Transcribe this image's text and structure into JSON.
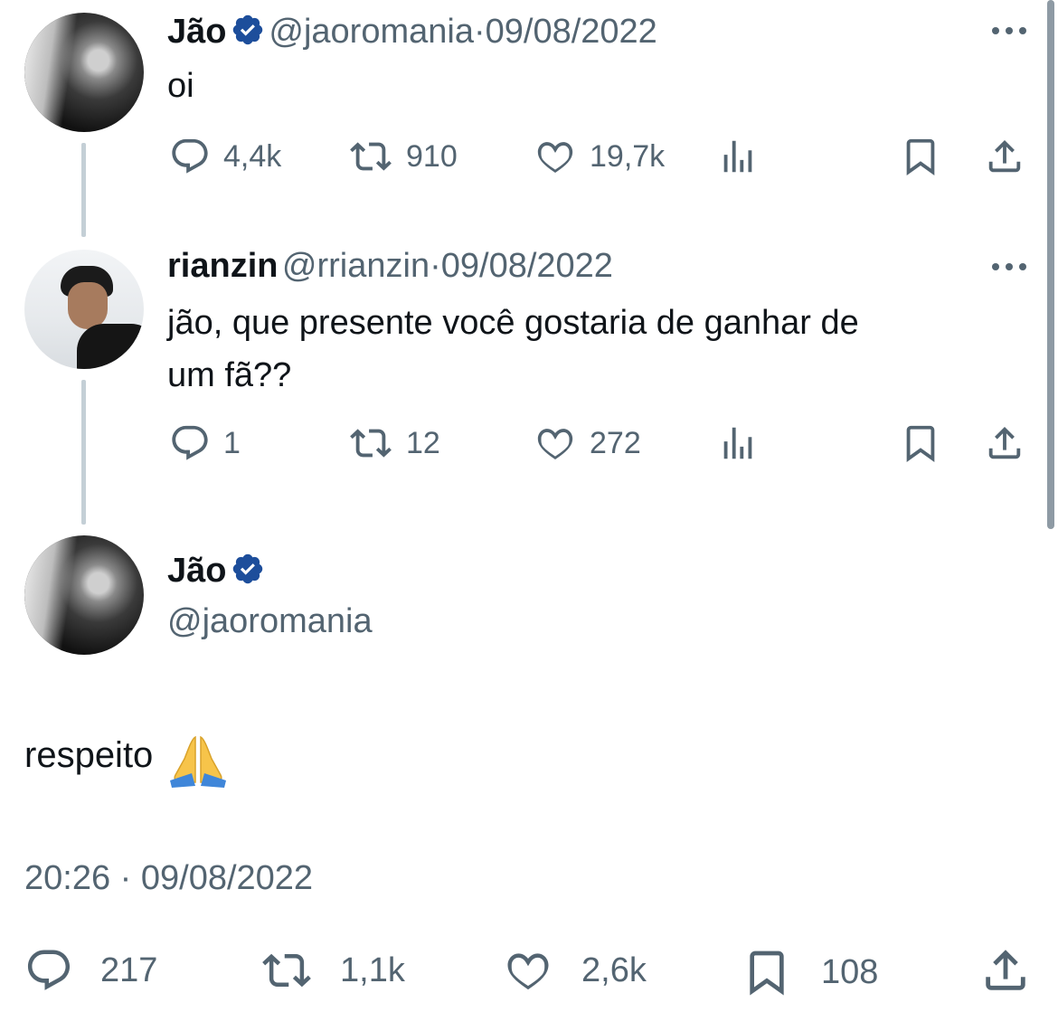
{
  "tweets": [
    {
      "name": "Jão",
      "handle": "@jaoromania",
      "date": "09/08/2022",
      "text": "oi",
      "replies": "4,4k",
      "retweets": "910",
      "likes": "19,7k"
    },
    {
      "name": "rianzin",
      "handle": "@rrianzin",
      "date": "09/08/2022",
      "text_line1": "jão, que presente você gostaria de ganhar de",
      "text_line2": "um fã??",
      "replies": "1",
      "retweets": "12",
      "likes": "272"
    }
  ],
  "main": {
    "name": "Jão",
    "handle": "@jaoromania",
    "text": "respeito",
    "emoji": "folded-hands",
    "time": "20:26",
    "date": "09/08/2022",
    "separator": "·",
    "replies": "217",
    "retweets": "1,1k",
    "likes": "2,6k",
    "bookmarks": "108"
  },
  "colors": {
    "text": "#0f1419",
    "secondary": "#536471",
    "verified": "#1d4e9b",
    "thread_line": "#c4cfd6"
  }
}
